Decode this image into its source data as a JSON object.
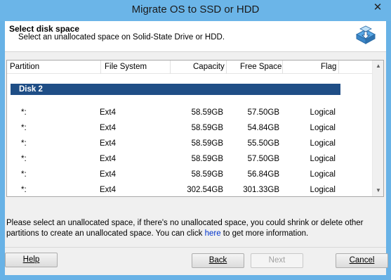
{
  "window": {
    "title": "Migrate OS to SSD or HDD",
    "close_glyph": "✕"
  },
  "header": {
    "title": "Select disk space",
    "subtitle": "Select an unallocated space on Solid-State Drive or HDD.",
    "icon": "disk-migrate-icon"
  },
  "table": {
    "columns": [
      "Partition",
      "File System",
      "Capacity",
      "Free Space",
      "Flag"
    ],
    "disk_label": "Disk 2",
    "rows": [
      {
        "partition": "*:",
        "fs": "Ext4",
        "capacity": "58.59GB",
        "free": "57.50GB",
        "flag": "Logical"
      },
      {
        "partition": "*:",
        "fs": "Ext4",
        "capacity": "58.59GB",
        "free": "54.84GB",
        "flag": "Logical"
      },
      {
        "partition": "*:",
        "fs": "Ext4",
        "capacity": "58.59GB",
        "free": "55.50GB",
        "flag": "Logical"
      },
      {
        "partition": "*:",
        "fs": "Ext4",
        "capacity": "58.59GB",
        "free": "57.50GB",
        "flag": "Logical"
      },
      {
        "partition": "*:",
        "fs": "Ext4",
        "capacity": "58.59GB",
        "free": "56.84GB",
        "flag": "Logical"
      },
      {
        "partition": "*:",
        "fs": "Ext4",
        "capacity": "302.54GB",
        "free": "301.33GB",
        "flag": "Logical"
      }
    ]
  },
  "info": {
    "line1": "Please select an unallocated space, if there's no unallocated space, you could shrink or delete other",
    "line2_pre": "partitions to create an unallocated space. You can click ",
    "link": "here",
    "line2_post": " to get more information."
  },
  "buttons": {
    "help": "Help",
    "back": "Back",
    "next": "Next",
    "cancel": "Cancel"
  },
  "colors": {
    "accent": "#1f4e86",
    "titlebar": "#6bb5e8",
    "link": "#0033cc"
  }
}
